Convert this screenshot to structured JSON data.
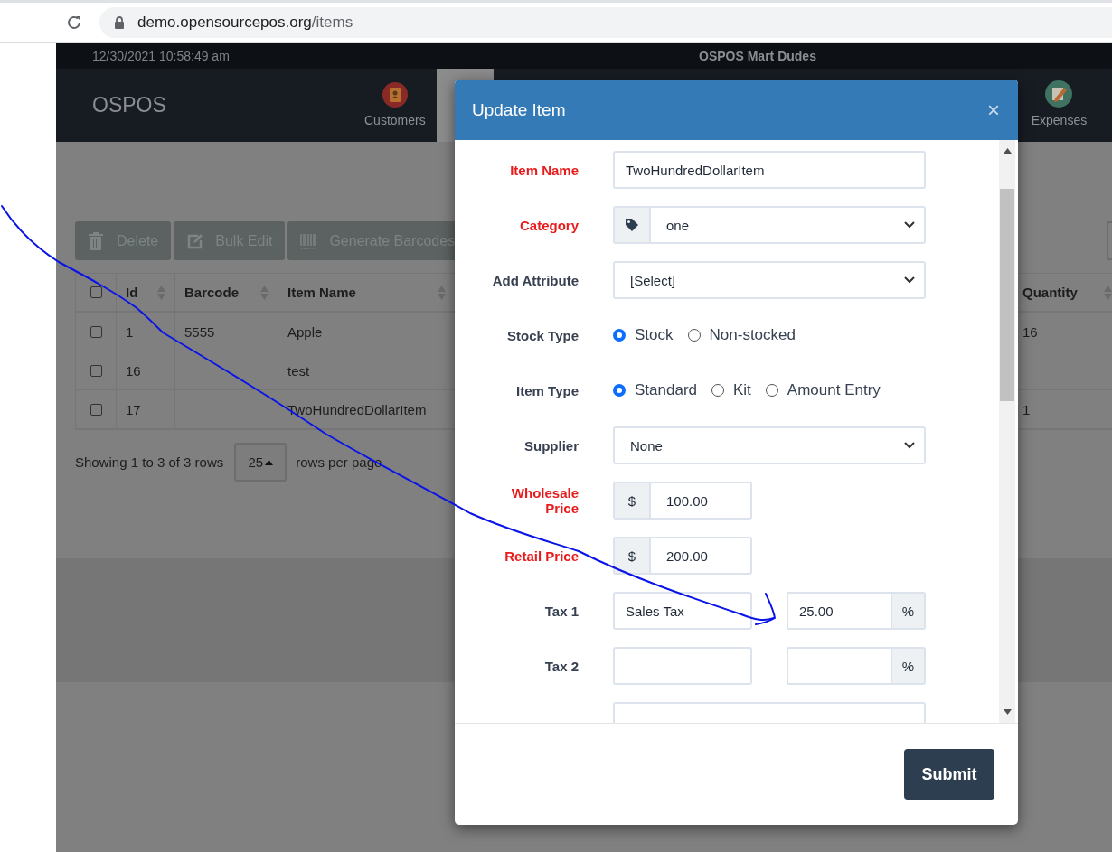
{
  "browser": {
    "url_host": "demo.opensourcepos.org",
    "url_path": "/items"
  },
  "header": {
    "datetime": "12/30/2021 10:58:49 am",
    "store_name": "OSPOS Mart Dudes",
    "brand": "OSPOS",
    "nav": [
      {
        "label": "Customers",
        "kind": "customers"
      },
      {
        "label": "Expenses",
        "kind": "expenses"
      }
    ]
  },
  "toolbar": [
    {
      "label": "Delete",
      "kind": "delete"
    },
    {
      "label": "Bulk Edit",
      "kind": "edit"
    },
    {
      "label": "Generate Barcodes",
      "kind": "barcode"
    }
  ],
  "table": {
    "columns": [
      "Id",
      "Barcode",
      "Item Name",
      "Quantity"
    ],
    "header_checked": false,
    "rows": [
      {
        "checked": false,
        "cells": [
          "1",
          "5555",
          "Apple",
          "16"
        ]
      },
      {
        "checked": false,
        "cells": [
          "16",
          "",
          "test",
          ""
        ]
      },
      {
        "checked": false,
        "cells": [
          "17",
          "",
          "TwoHundredDollarItem",
          "1"
        ]
      }
    ]
  },
  "pagination": {
    "summary": "Showing 1 to 3 of 3 rows",
    "page_size": "25",
    "suffix": "rows per page"
  },
  "modal": {
    "title": "Update Item",
    "close": "×",
    "submit": "Submit",
    "fields": [
      {
        "kind": "text",
        "label": "Item Name",
        "required": true,
        "value": "TwoHundredDollarItem"
      },
      {
        "kind": "addon_select",
        "label": "Category",
        "required": true,
        "value": "one"
      },
      {
        "kind": "select",
        "label": "Add Attribute",
        "required": false,
        "value": "[Select]"
      },
      {
        "kind": "radios",
        "label": "Stock Type",
        "required": false,
        "options": [
          {
            "label": "Stock",
            "selected": true
          },
          {
            "label": "Non-stocked",
            "selected": false
          }
        ]
      },
      {
        "kind": "radios",
        "label": "Item Type",
        "required": false,
        "options": [
          {
            "label": "Standard",
            "selected": true
          },
          {
            "label": "Kit",
            "selected": false
          },
          {
            "label": "Amount Entry",
            "selected": false
          }
        ]
      },
      {
        "kind": "select",
        "label": "Supplier",
        "required": false,
        "value": "None"
      },
      {
        "kind": "prefix_input",
        "label": "Wholesale Price",
        "required": true,
        "prefix": "$",
        "value": "100.00"
      },
      {
        "kind": "prefix_input",
        "label": "Retail Price",
        "required": true,
        "prefix": "$",
        "value": "200.00"
      },
      {
        "kind": "tax",
        "label": "Tax 1",
        "required": false,
        "name": "Sales Tax",
        "rate": "25.00",
        "suffix": "%"
      },
      {
        "kind": "tax",
        "label": "Tax 2",
        "required": false,
        "suffix": "%"
      },
      {
        "kind": "text"
      }
    ]
  }
}
